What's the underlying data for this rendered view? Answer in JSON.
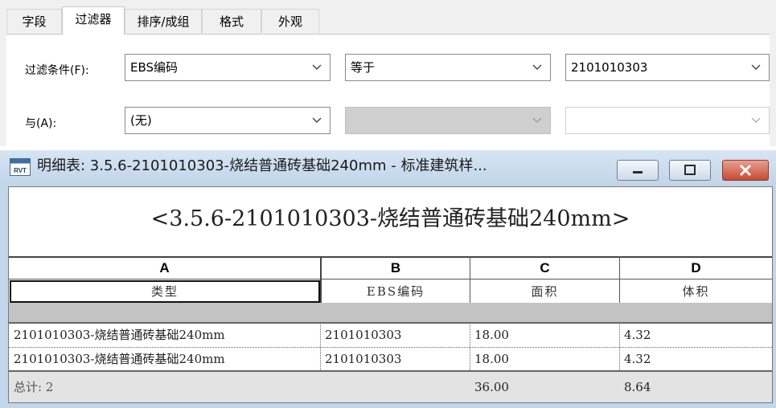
{
  "filter_dialog": {
    "tabs": [
      {
        "label": "字段"
      },
      {
        "label": "过滤器"
      },
      {
        "label": "排序/成组"
      },
      {
        "label": "格式"
      },
      {
        "label": "外观"
      }
    ],
    "filter_row": {
      "label": "过滤条件(F):",
      "field_value": "EBS编码",
      "operator_value": "等于",
      "value": "2101010303"
    },
    "and_row": {
      "label": "与(A):",
      "field_value": "(无)",
      "operator_value": "",
      "value": ""
    }
  },
  "schedule_window": {
    "title": "明细表: 3.5.6-2101010303-烧结普通砖基础240mm - 标准建筑样...",
    "icon_text": "RVT",
    "sheet_title": "<3.5.6-2101010303-烧结普通砖基础240mm>",
    "columns": [
      {
        "letter": "A",
        "header": "类型"
      },
      {
        "letter": "B",
        "header": "EBS编码"
      },
      {
        "letter": "C",
        "header": "面积"
      },
      {
        "letter": "D",
        "header": "体积"
      }
    ],
    "rows": [
      [
        "2101010303-烧结普通砖基础240mm",
        "2101010303",
        "18.00",
        "4.32"
      ],
      [
        "2101010303-烧结普通砖基础240mm",
        "2101010303",
        "18.00",
        "4.32"
      ]
    ],
    "totals": {
      "label": "总计: 2",
      "area": "36.00",
      "volume": "8.64"
    }
  }
}
